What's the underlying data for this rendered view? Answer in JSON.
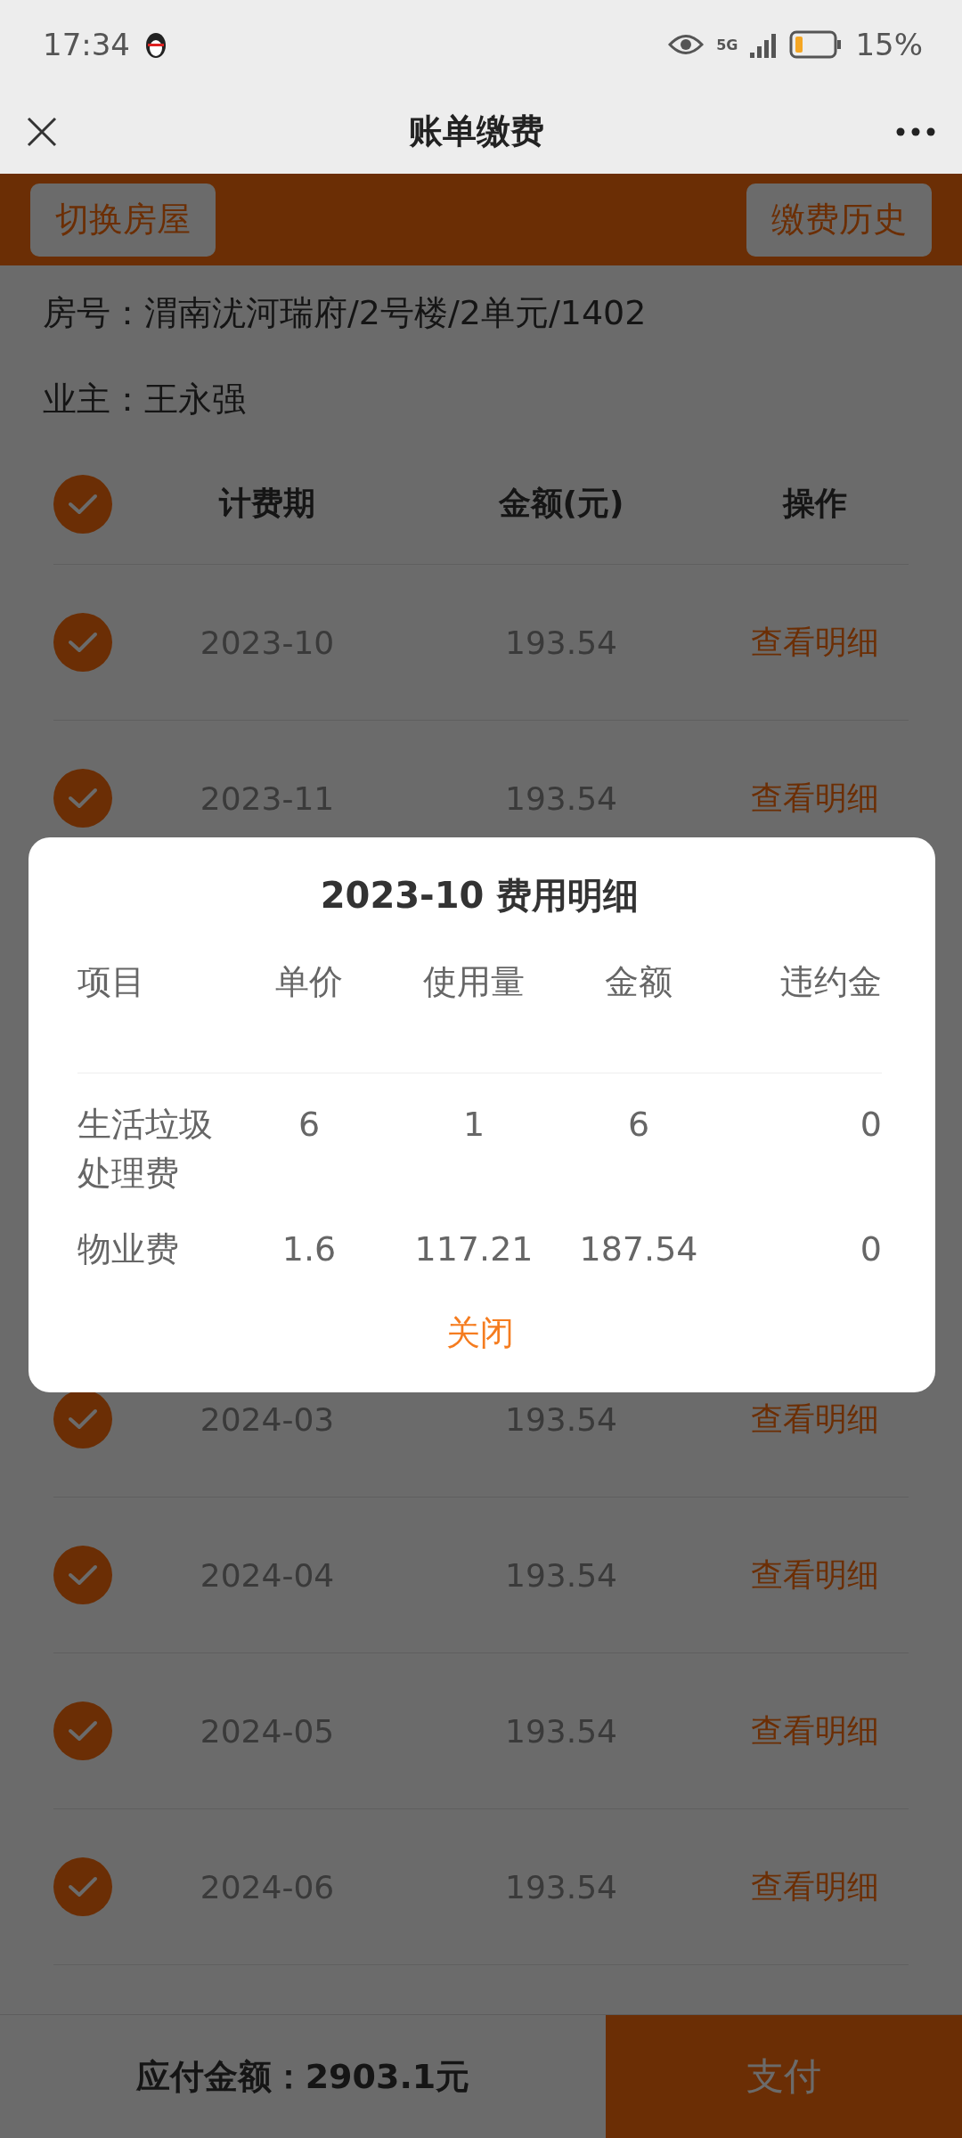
{
  "status_bar": {
    "time": "17:34",
    "network": "5G",
    "battery": "15%"
  },
  "nav": {
    "title": "账单缴费"
  },
  "toolbar": {
    "buttons": [
      "切换房屋",
      "缴费历史"
    ]
  },
  "info": [
    "房号：渭南沋河瑞府/2号楼/2单元/1402",
    "业主：王永强"
  ],
  "table": {
    "all_checked": true,
    "columns": [
      "计费期",
      "金额(元)",
      "操作"
    ],
    "rows": [
      {
        "period": "2023-10",
        "amount": "193.54",
        "action": "查看明细",
        "checked": true
      },
      {
        "period": "2023-11",
        "amount": "193.54",
        "action": "查看明细",
        "checked": true
      },
      {
        "period": "2024-03",
        "amount": "193.54",
        "action": "查看明细",
        "checked": true
      },
      {
        "period": "2024-04",
        "amount": "193.54",
        "action": "查看明细",
        "checked": true
      },
      {
        "period": "2024-05",
        "amount": "193.54",
        "action": "查看明细",
        "checked": true
      },
      {
        "period": "2024-06",
        "amount": "193.54",
        "action": "查看明细",
        "checked": true
      }
    ]
  },
  "dialog": {
    "title": "2023-10 费用明细",
    "columns": [
      "项目",
      "单价",
      "使用量",
      "金额",
      "违约金"
    ],
    "rows": [
      [
        "生活垃圾处理费",
        "6",
        "1",
        "6",
        "0"
      ],
      [
        "物业费",
        "1.6",
        "117.21",
        "187.54",
        "0"
      ]
    ],
    "close": "关闭"
  },
  "footer": {
    "total": "应付金额：2903.1元",
    "pay": "支付"
  }
}
